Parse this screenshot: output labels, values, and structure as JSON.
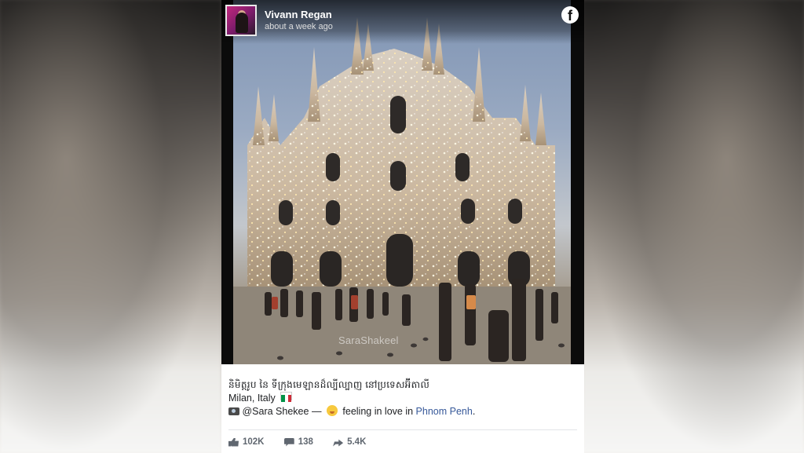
{
  "post": {
    "author": "Vivann Regan",
    "timestamp": "about a week ago",
    "platform_icon": "facebook-f-icon",
    "photo": {
      "subject": "sparkling-cathedral-photo",
      "watermark": "SaraShakeel"
    },
    "caption": {
      "khmer_line": "និមិត្តរូប នៃ ទីក្រុងមេឡានដ៏ល្បីល្បាញ នៅប្រទេសអ៊ីតាលី",
      "location_line": "Milan, Italy",
      "flag_colors": [
        "#009246",
        "#ffffff",
        "#ce2b37"
      ],
      "credit_icon": "camera-icon",
      "credit_name": "@Sara Shekee",
      "separator": "—",
      "feeling_icon": "in-love-emoji-icon",
      "feeling_text": "feeling in love in",
      "feeling_place": "Phnom Penh",
      "trailing": "."
    },
    "stats": {
      "likes": "102K",
      "comments": "138",
      "shares": "5.4K"
    }
  },
  "colors": {
    "link": "#365899",
    "stats_text": "#606770",
    "body_text": "#1c1e21"
  }
}
